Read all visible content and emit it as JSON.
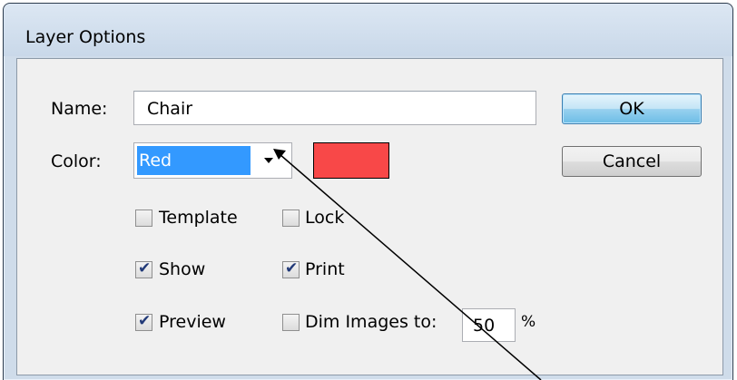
{
  "dialog": {
    "title": "Layer Options",
    "name_label": "Name:",
    "name_value": "Chair",
    "color_label": "Color:",
    "color_value": "Red",
    "color_swatch": "#f84848",
    "ok_label": "OK",
    "cancel_label": "Cancel"
  },
  "options": {
    "template": {
      "label": "Template",
      "checked": false
    },
    "lock": {
      "label": "Lock",
      "checked": false
    },
    "show": {
      "label": "Show",
      "checked": true
    },
    "print": {
      "label": "Print",
      "checked": true
    },
    "preview": {
      "label": "Preview",
      "checked": true
    },
    "dim": {
      "label": "Dim Images to:",
      "checked": false,
      "value": "50",
      "unit": "%"
    }
  },
  "colors": {
    "accent": "#3399ff",
    "window_frame": "#cfdcea",
    "client_bg": "#f0f0f0"
  },
  "icons": {
    "checkmark": "check-icon",
    "dropdown": "chevron-down-icon"
  }
}
